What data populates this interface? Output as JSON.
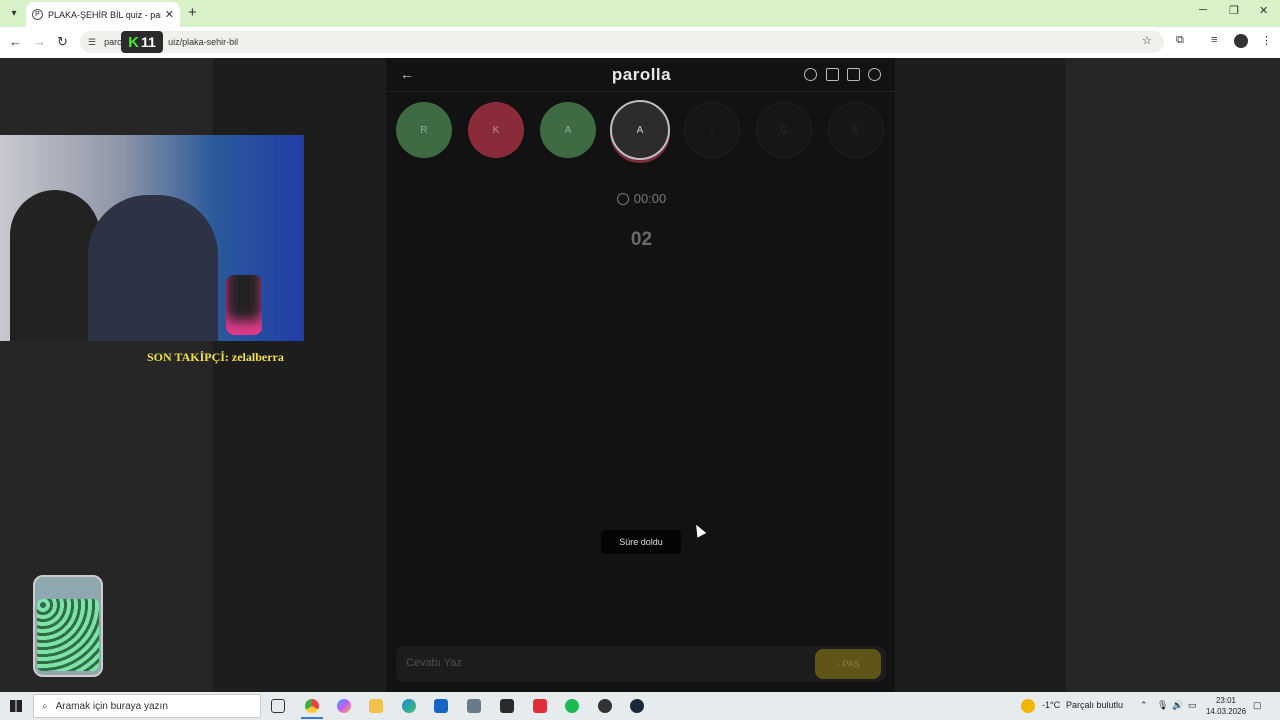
{
  "browser": {
    "tab_title": "PLAKA-ŞEHİR BİL quiz - parolla",
    "tab_favicon": "P",
    "url_prefix": "paro",
    "url_suffix": "uiz/plaka-sehir-bil",
    "new_tab": "+",
    "minimize": "─",
    "restore": "❐",
    "close": "✕"
  },
  "stream_badge": {
    "letter": "K",
    "number": "11"
  },
  "app": {
    "logo": "parolla",
    "letters": [
      {
        "char": "R",
        "state": "correct"
      },
      {
        "char": "K",
        "state": "wrong"
      },
      {
        "char": "A",
        "state": "correct"
      },
      {
        "char": "A",
        "state": "active"
      },
      {
        "char": "I",
        "state": "empty"
      },
      {
        "char": "Ç",
        "state": "empty"
      },
      {
        "char": "E",
        "state": "empty"
      }
    ],
    "timer": "00:00",
    "score": "02",
    "toast": "Süre doldu",
    "answer_placeholder": "Cevabı Yaz",
    "pass_label": "PAS",
    "pass_icon": "›"
  },
  "overlay": {
    "follower_text": "SON TAKİPÇİ: zelalberra"
  },
  "taskbar": {
    "search_placeholder": "Aramak için buraya yazın",
    "weather_temp": "-1°C",
    "weather_text": "Parçalı bulutlu",
    "time": "23:01",
    "date": "14.03.2026"
  },
  "colors": {
    "correct": "#3e6a44",
    "wrong": "#8a2b3a",
    "pass_button": "#5f5518",
    "follower_text": "#f0e14a",
    "tabbar": "#d8f1c8"
  }
}
